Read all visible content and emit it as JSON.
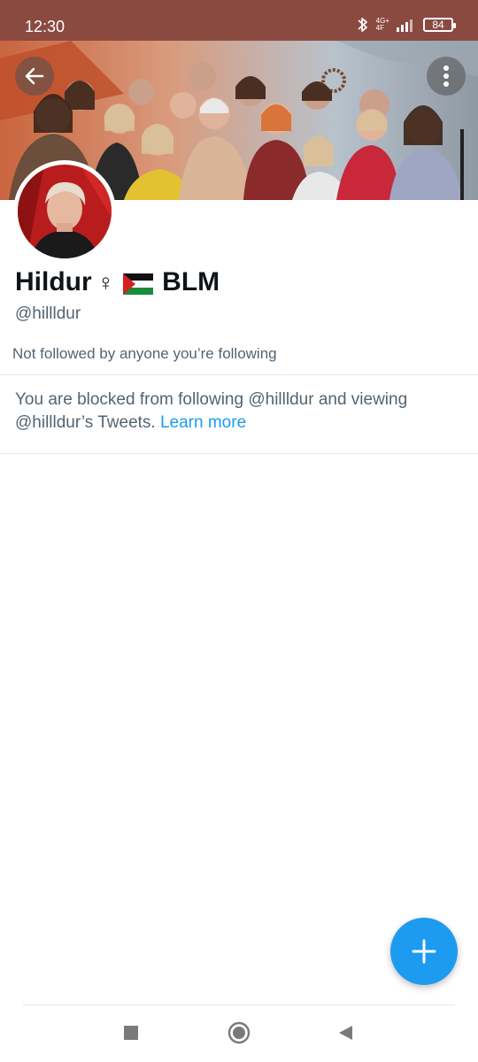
{
  "status_bar": {
    "time": "12:30",
    "network_top": "4G+",
    "network_bottom": "4F",
    "battery": "84",
    "icons": [
      "bluetooth-icon",
      "signal-icon",
      "battery-icon"
    ]
  },
  "header": {
    "back_icon": "arrow-left-icon",
    "more_icon": "more-vertical-icon"
  },
  "profile": {
    "name_part": "Hildur",
    "gender_symbol": "♀",
    "flag_icon": "palestine-flag-icon",
    "name_suffix": "BLM",
    "handle": "@hillldur",
    "followers_note": "Not followed by anyone you’re following",
    "blocked_message": "You are blocked from following @hillldur and viewing @hillldur’s Tweets.",
    "learn_more": "Learn more"
  },
  "fab": {
    "icon": "plus-icon"
  },
  "nav": {
    "icons": [
      "recent-apps-icon",
      "home-icon",
      "back-triangle-icon"
    ]
  },
  "colors": {
    "status_bar": "#8b4a40",
    "accent": "#1d9bf0",
    "secondary_text": "#536471",
    "primary_text": "#0f1419"
  }
}
